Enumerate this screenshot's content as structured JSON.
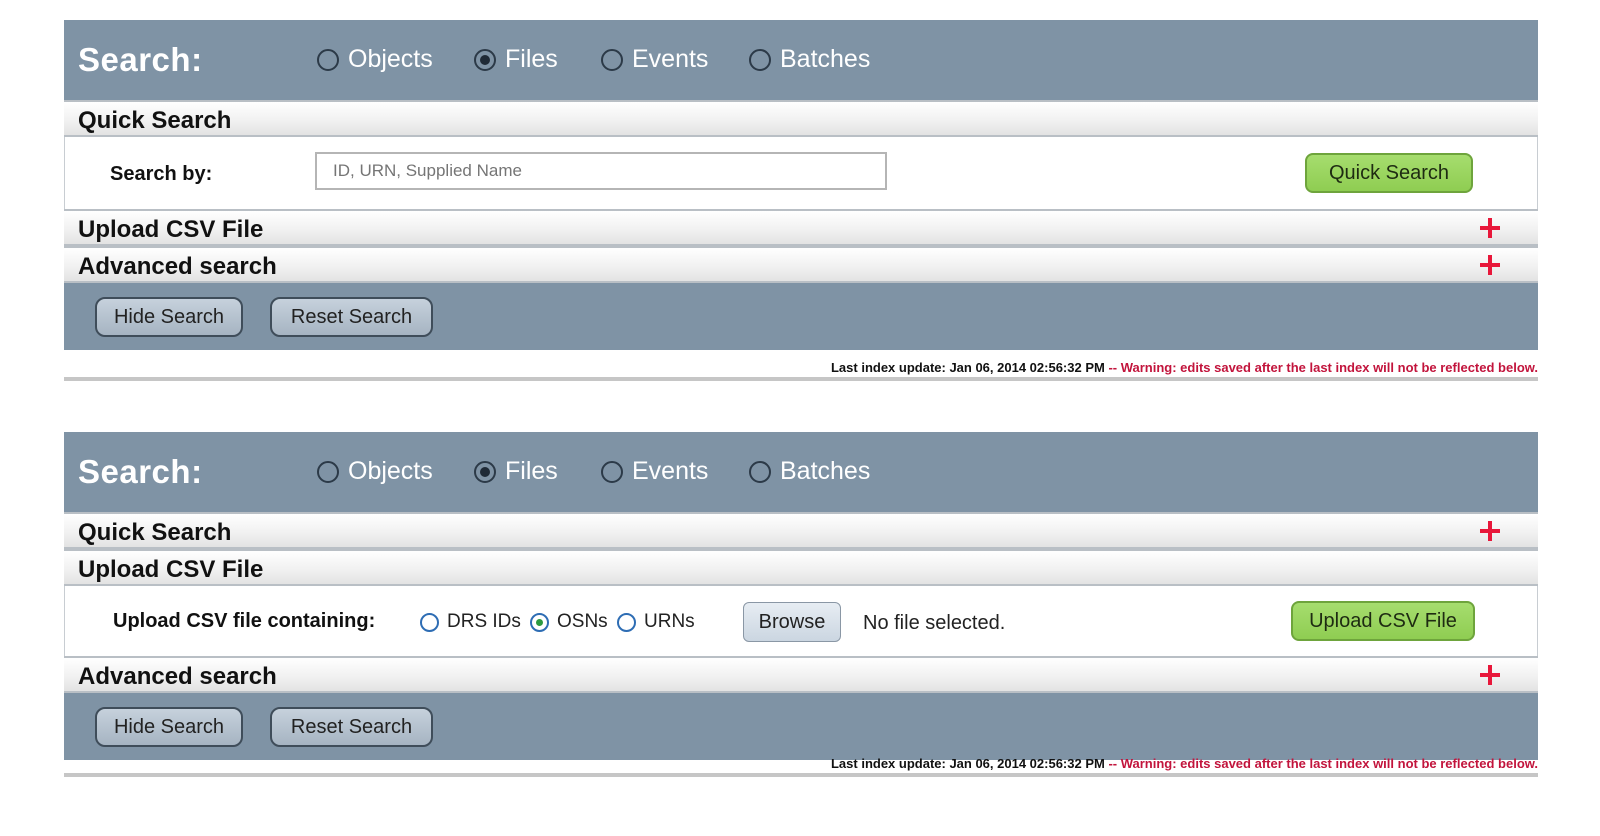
{
  "panel1": {
    "title": "Search:",
    "types": [
      {
        "label": "Objects",
        "checked": false
      },
      {
        "label": "Files",
        "checked": true
      },
      {
        "label": "Events",
        "checked": false
      },
      {
        "label": "Batches",
        "checked": false
      }
    ],
    "quick_search": {
      "title": "Quick Search",
      "search_by_label": "Search by:",
      "input_placeholder": "ID, URN, Supplied Name",
      "button_label": "Quick Search"
    },
    "upload_csv": {
      "title": "Upload CSV File",
      "collapsed": true
    },
    "advanced": {
      "title": "Advanced search",
      "collapsed": true
    },
    "hide_button": "Hide Search",
    "reset_button": "Reset Search",
    "status": {
      "last_update": "Last index update: Jan 06, 2014 02:56:32 PM",
      "warning": " -- Warning: edits saved after the last index will not be reflected below."
    }
  },
  "panel2": {
    "title": "Search:",
    "types": [
      {
        "label": "Objects",
        "checked": false
      },
      {
        "label": "Files",
        "checked": true
      },
      {
        "label": "Events",
        "checked": false
      },
      {
        "label": "Batches",
        "checked": false
      }
    ],
    "quick_search": {
      "title": "Quick Search",
      "collapsed": true
    },
    "upload_csv": {
      "title": "Upload CSV File",
      "containing_label": "Upload CSV file containing:",
      "id_types": [
        {
          "label": "DRS IDs",
          "checked": false
        },
        {
          "label": "OSNs",
          "checked": true
        },
        {
          "label": "URNs",
          "checked": false
        }
      ],
      "browse_label": "Browse",
      "file_status": "No file selected.",
      "button_label": "Upload CSV File"
    },
    "advanced": {
      "title": "Advanced search",
      "collapsed": true
    },
    "hide_button": "Hide Search",
    "reset_button": "Reset Search",
    "status": {
      "last_update": "Last index update: Jan 06, 2014 02:56:32 PM",
      "warning": " -- Warning: edits saved after the last index will not be reflected below."
    }
  },
  "colors": {
    "header_bg": "#7f93a5",
    "green_button": "#9ad45f",
    "plus_icon": "#e8173a",
    "warning_text": "#c2143c"
  }
}
